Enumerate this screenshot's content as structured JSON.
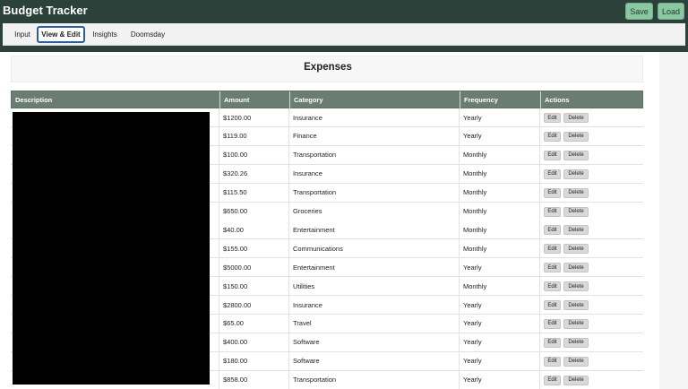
{
  "header": {
    "title": "Budget Tracker",
    "save_label": "Save",
    "load_label": "Load"
  },
  "tabs": [
    {
      "label": "Input"
    },
    {
      "label": "View & Edit",
      "active": true
    },
    {
      "label": "Insights"
    },
    {
      "label": "Doomsday"
    }
  ],
  "panel": {
    "title": "Expenses"
  },
  "table": {
    "columns": [
      "Description",
      "Amount",
      "Category",
      "Frequency",
      "Actions"
    ],
    "edit_label": "Edit",
    "delete_label": "Delete",
    "rows": [
      {
        "amount": "$1200.00",
        "category": "Insurance",
        "frequency": "Yearly"
      },
      {
        "amount": "$119.00",
        "category": "Finance",
        "frequency": "Yearly"
      },
      {
        "amount": "$100.00",
        "category": "Transportation",
        "frequency": "Monthly"
      },
      {
        "amount": "$320.26",
        "category": "Insurance",
        "frequency": "Monthly"
      },
      {
        "amount": "$115.50",
        "category": "Transportation",
        "frequency": "Monthly"
      },
      {
        "amount": "$650.00",
        "category": "Groceries",
        "frequency": "Monthly"
      },
      {
        "amount": "$40.00",
        "category": "Entertainment",
        "frequency": "Monthly"
      },
      {
        "amount": "$155.00",
        "category": "Communications",
        "frequency": "Monthly"
      },
      {
        "amount": "$5000.00",
        "category": "Entertainment",
        "frequency": "Yearly"
      },
      {
        "amount": "$150.00",
        "category": "Utilities",
        "frequency": "Monthly"
      },
      {
        "amount": "$2800.00",
        "category": "Insurance",
        "frequency": "Yearly"
      },
      {
        "amount": "$65.00",
        "category": "Travel",
        "frequency": "Yearly"
      },
      {
        "amount": "$400.00",
        "category": "Software",
        "frequency": "Yearly"
      },
      {
        "amount": "$180.00",
        "category": "Software",
        "frequency": "Yearly"
      },
      {
        "amount": "$858.00",
        "category": "Transportation",
        "frequency": "Yearly"
      }
    ]
  }
}
